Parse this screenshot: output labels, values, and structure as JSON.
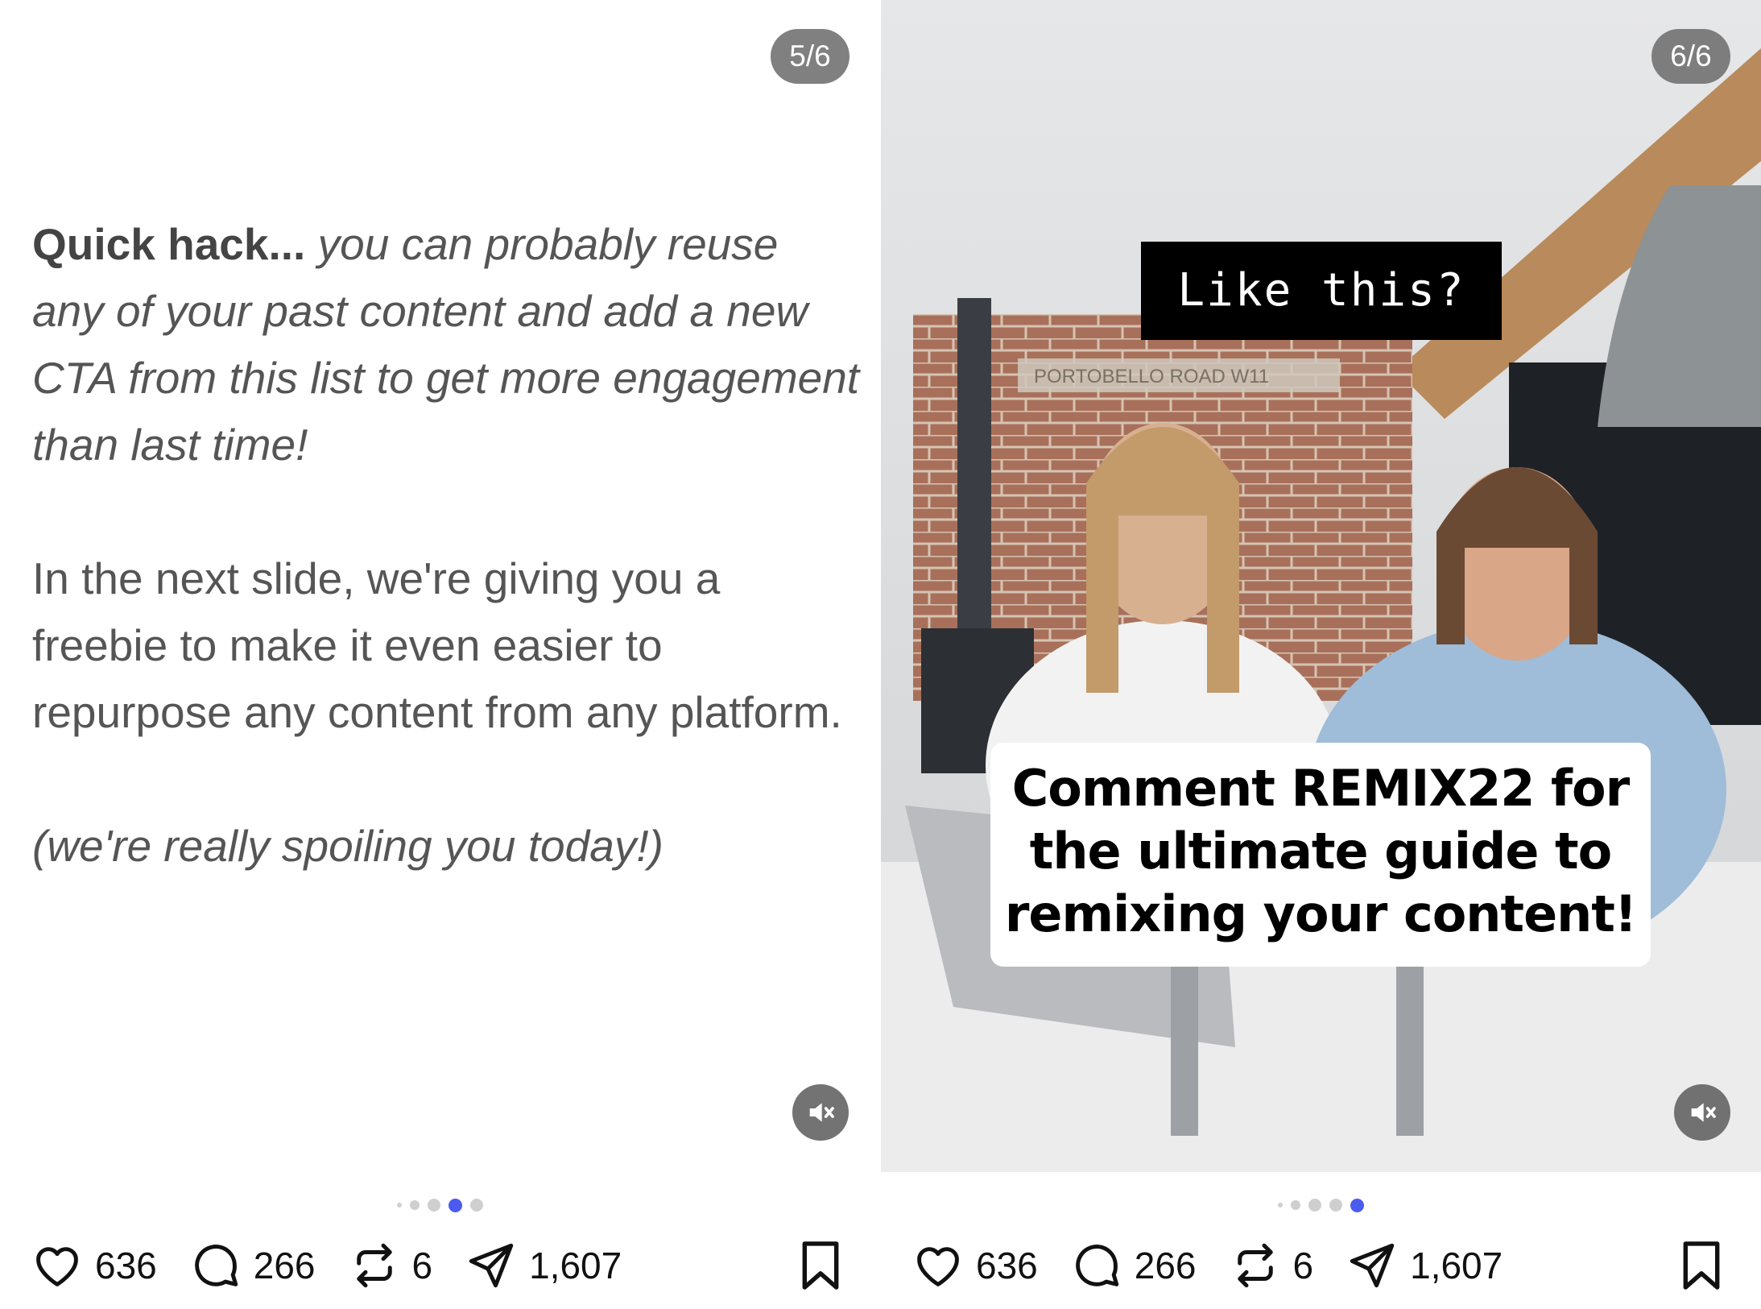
{
  "left_post": {
    "counter": "5/6",
    "intro_bold": "Quick hack...",
    "intro_italic": "you can probably reuse any of your past content and add a new CTA from this list to get more engagement than last time!",
    "paragraph": "In the next slide, we're giving you a freebie to make it even easier to repurpose any content from any platform.",
    "closing": "(we're really spoiling you today!)",
    "stats": {
      "likes": "636",
      "comments": "266",
      "reposts": "6",
      "shares": "1,607"
    },
    "active_dot_index": 3
  },
  "right_post": {
    "counter": "6/6",
    "caption_top": "Like this?",
    "caption_bottom": "Comment REMIX22 for the ultimate guide to remixing your content!",
    "sign_text": "PORTOBELLO ROAD W11",
    "stats": {
      "likes": "636",
      "comments": "266",
      "reposts": "6",
      "shares": "1,607"
    },
    "active_dot_index": 4
  },
  "icons": [
    "heart-icon",
    "comment-icon",
    "repost-icon",
    "send-icon",
    "bookmark-icon",
    "mute-icon"
  ],
  "colors": {
    "accent_dot": "#4a5bf0",
    "text_gray": "#555555",
    "counter_bg": "#6e6e6e"
  }
}
